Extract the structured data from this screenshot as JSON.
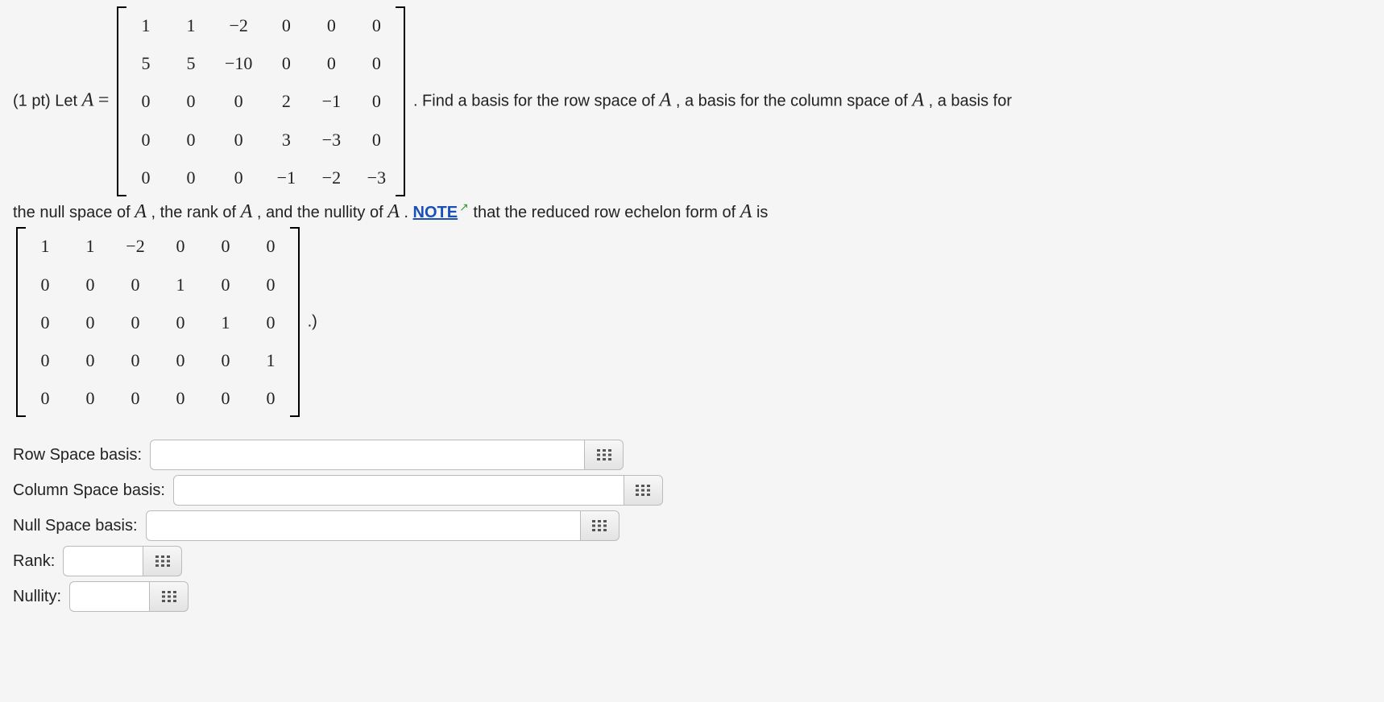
{
  "problem": {
    "points_prefix": "(1 pt) Let ",
    "A_eq": "A = ",
    "intro_after_matrix": ". Find a basis for the row space of ",
    "A": "A",
    "intro_comma": ", a basis for the column space of ",
    "intro_end": ", a basis for",
    "line2_a": "the null space of ",
    "line2_b": ", the rank of ",
    "line2_c": ", and the nullity of ",
    "line2_period": ".  ",
    "note": "NOTE",
    "line2_after_note": " that the reduced row echelon form of ",
    "line2_is": " is",
    "paren_close": ".)"
  },
  "matrix_A": [
    [
      "1",
      "1",
      "−2",
      "0",
      "0",
      "0"
    ],
    [
      "5",
      "5",
      "−10",
      "0",
      "0",
      "0"
    ],
    [
      "0",
      "0",
      "0",
      "2",
      "−1",
      "0"
    ],
    [
      "0",
      "0",
      "0",
      "3",
      "−3",
      "0"
    ],
    [
      "0",
      "0",
      "0",
      "−1",
      "−2",
      "−3"
    ]
  ],
  "matrix_rref": [
    [
      "1",
      "1",
      "−2",
      "0",
      "0",
      "0"
    ],
    [
      "0",
      "0",
      "0",
      "1",
      "0",
      "0"
    ],
    [
      "0",
      "0",
      "0",
      "0",
      "1",
      "0"
    ],
    [
      "0",
      "0",
      "0",
      "0",
      "0",
      "1"
    ],
    [
      "0",
      "0",
      "0",
      "0",
      "0",
      "0"
    ]
  ],
  "answers": {
    "row_space_label": "Row Space basis:",
    "col_space_label": "Column Space basis:",
    "null_space_label": "Null Space basis:",
    "rank_label": "Rank:",
    "nullity_label": "Nullity:",
    "row_space_value": "",
    "col_space_value": "",
    "null_space_value": "",
    "rank_value": "",
    "nullity_value": ""
  }
}
